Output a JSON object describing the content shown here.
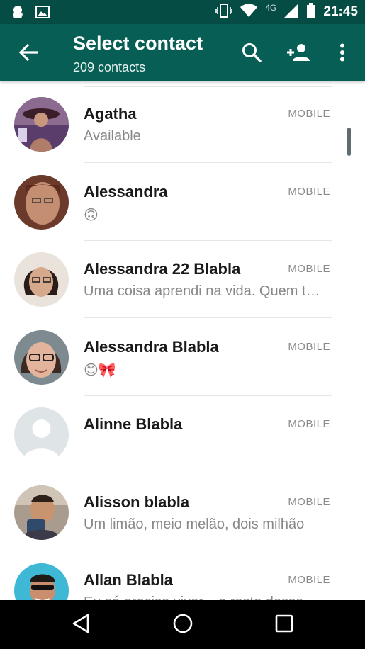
{
  "status_bar": {
    "time": "21:45",
    "network": "4G",
    "icons": [
      "notification-app-icon",
      "gallery-icon",
      "vibrate-icon",
      "wifi-icon",
      "signal-icon",
      "battery-icon"
    ]
  },
  "app_bar": {
    "title": "Select contact",
    "subtitle": "209 contacts",
    "icons": [
      "back-arrow-icon",
      "search-icon",
      "add-contact-icon",
      "more-vert-icon"
    ],
    "color": "#075e54"
  },
  "contacts": [
    {
      "name": "Agatha",
      "type": "MOBILE",
      "status": "Available"
    },
    {
      "name": "Alessandra",
      "type": "MOBILE",
      "status": "🙃"
    },
    {
      "name": "Alessandra 22 Blabla",
      "type": "MOBILE",
      "status": "Uma coisa aprendi na vida. Quem t…"
    },
    {
      "name": "Alessandra Blabla",
      "type": "MOBILE",
      "status": "😊🎀"
    },
    {
      "name": "Alinne Blabla",
      "type": "MOBILE",
      "status": ""
    },
    {
      "name": "Alisson blabla",
      "type": "MOBILE",
      "status": "Um limão, meio melão, dois milhão"
    },
    {
      "name": "Allan Blabla",
      "type": "MOBILE",
      "status": "Eu só preciso viver... e resto desse"
    }
  ],
  "nav_bar": {
    "icons": [
      "back-triangle-icon",
      "home-circle-icon",
      "recents-square-icon"
    ]
  }
}
